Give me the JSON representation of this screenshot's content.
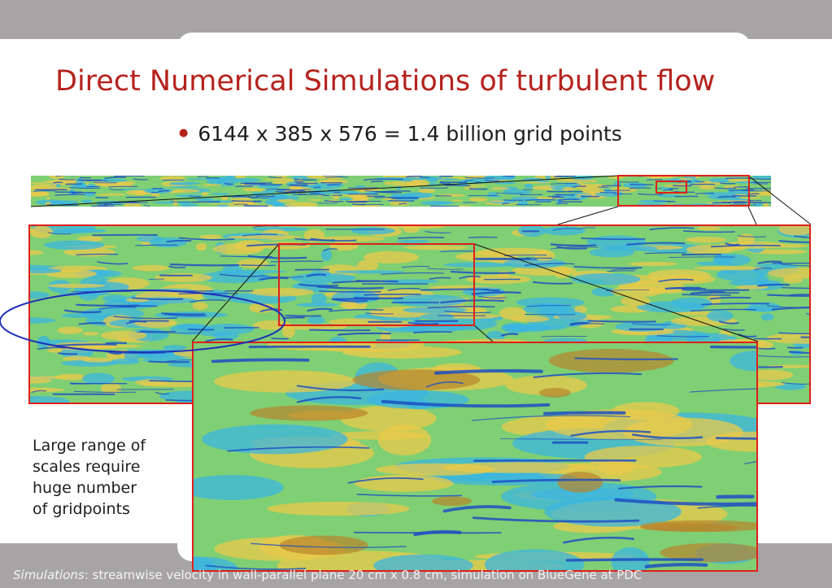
{
  "slide": {
    "title": "Direct Numerical Simulations of turbulent flow",
    "bullet": "6144 x 385 x 576 = 1.4 billion grid points",
    "side_note_lines": [
      "Large range of",
      "scales require",
      "huge number",
      "of gridpoints"
    ],
    "caption_italic": "Simulations",
    "caption_rest": ": streamwise velocity in wall-parallel plane 20 cm x 0.8 cm, simulation on BlueGene at PDC"
  },
  "colors": {
    "title": "#b5231d",
    "band": "#a7a4a6",
    "highlight_box": "#e0201a",
    "ellipse": "#1f2fb8",
    "field_green": "#7fcf74",
    "field_yellow": "#e9c94a",
    "field_blue": "#1b4fc4",
    "field_cyan": "#3bb6e0",
    "field_brown": "#b8842c"
  },
  "images": [
    {
      "name": "full-domain-strip",
      "zoom_level": "full"
    },
    {
      "name": "zoom-level-1",
      "zoom_level": "1"
    },
    {
      "name": "zoom-level-2",
      "zoom_level": "2"
    }
  ]
}
